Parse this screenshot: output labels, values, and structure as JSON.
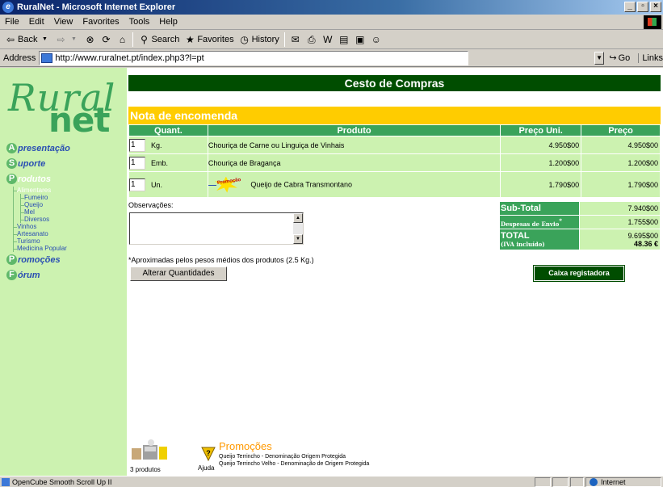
{
  "window": {
    "title": "RuralNet - Microsoft Internet Explorer"
  },
  "menu": [
    "File",
    "Edit",
    "View",
    "Favorites",
    "Tools",
    "Help"
  ],
  "toolbar": {
    "back": "Back",
    "search": "Search",
    "favorites": "Favorites",
    "history": "History"
  },
  "address": {
    "label": "Address",
    "url": "http://www.ruralnet.pt/index.php3?l=pt",
    "go": "Go",
    "links": "Links"
  },
  "logo": {
    "top": "Rural",
    "bottom": "net"
  },
  "sidebar": {
    "items": [
      {
        "badge": "A",
        "label": "presentação"
      },
      {
        "badge": "S",
        "label": "uporte"
      },
      {
        "badge": "P",
        "label": "rodutos"
      }
    ],
    "sub_alimentares": "Alimentares",
    "sub_food": [
      "Fumeiro",
      "Queijo",
      "Mel",
      "Diversos"
    ],
    "sub_other": [
      "Vinhos",
      "Artesanato",
      "Turismo",
      "Medicina Popular"
    ],
    "items2": [
      {
        "badge": "P",
        "label": "romoções"
      },
      {
        "badge": "F",
        "label": "órum"
      }
    ]
  },
  "page": {
    "header": "Cesto de Compras",
    "section": "Nota de encomenda",
    "columns": [
      "Quant.",
      "Produto",
      "Preço Uni.",
      "Preço"
    ],
    "rows": [
      {
        "qty": "1",
        "unit": "Kg.",
        "product": "Chouriça de Carne ou Linguiça de Vinhais",
        "unit_price": "4.950$00",
        "price": "4.950$00",
        "promo": false
      },
      {
        "qty": "1",
        "unit": "Emb.",
        "product": "Chouriça de Bragança",
        "unit_price": "1.200$00",
        "price": "1.200$00",
        "promo": false
      },
      {
        "qty": "1",
        "unit": "Un.",
        "product": "Queijo de Cabra Transmontano",
        "unit_price": "1.790$00",
        "price": "1.790$00",
        "promo": true
      }
    ],
    "promo_tag": "Promoção",
    "observations_label": "Observações:",
    "totals": {
      "subtotal_label": "Sub-Total",
      "subtotal": "7.940$00",
      "shipping_label": "Despesas de Envio",
      "shipping_mark": "*",
      "shipping": "1.755$00",
      "total_label": "TOTAL",
      "vat_label": "(IVA incluído)",
      "total": "9.695$00",
      "total_eur": "48.36 €"
    },
    "footnote": "*Aproximadas pelos pesos médios dos produtos (2.5 Kg.)",
    "alterar": "Alterar Quantidades",
    "caixa": "Caixa registadora"
  },
  "bottom": {
    "cart_label": "3 produtos",
    "help_label": "Ajuda",
    "promo_title": "Promoções",
    "promo_lines": [
      "Queijo Terrincho - Denominação Origem Protegida",
      "Queijo Terrincho Velho - Denominação de Origem Protegida"
    ]
  },
  "status": {
    "text": "OpenCube Smooth Scroll Up II",
    "zone": "Internet"
  },
  "colors": {
    "dark_green": "#004d00",
    "mid_green": "#3aa35a",
    "light_green": "#ccf2b0",
    "yellow": "#ffcc00",
    "orange": "#ff9900",
    "link_blue": "#2a4fb3"
  }
}
